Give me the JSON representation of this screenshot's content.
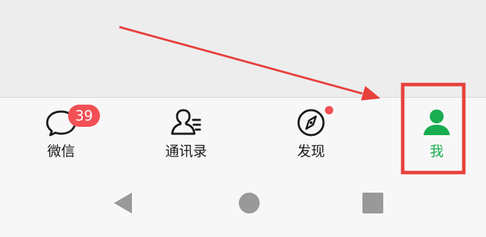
{
  "tabs": [
    {
      "key": "chats",
      "label": "微信",
      "icon": "chat-bubble-icon",
      "badge": "39"
    },
    {
      "key": "contacts",
      "label": "通讯录",
      "icon": "contacts-icon"
    },
    {
      "key": "discover",
      "label": "发现",
      "icon": "compass-icon",
      "has_dot": true
    },
    {
      "key": "me",
      "label": "我",
      "icon": "person-icon",
      "active": true
    }
  ],
  "nav": {
    "back": "triangle-back-icon",
    "home": "circle-home-icon",
    "recents": "square-recents-icon"
  },
  "colors": {
    "active": "#19ad4f",
    "badge": "#f25055",
    "annotation": "#e8403b",
    "nav_icon": "#999999"
  }
}
